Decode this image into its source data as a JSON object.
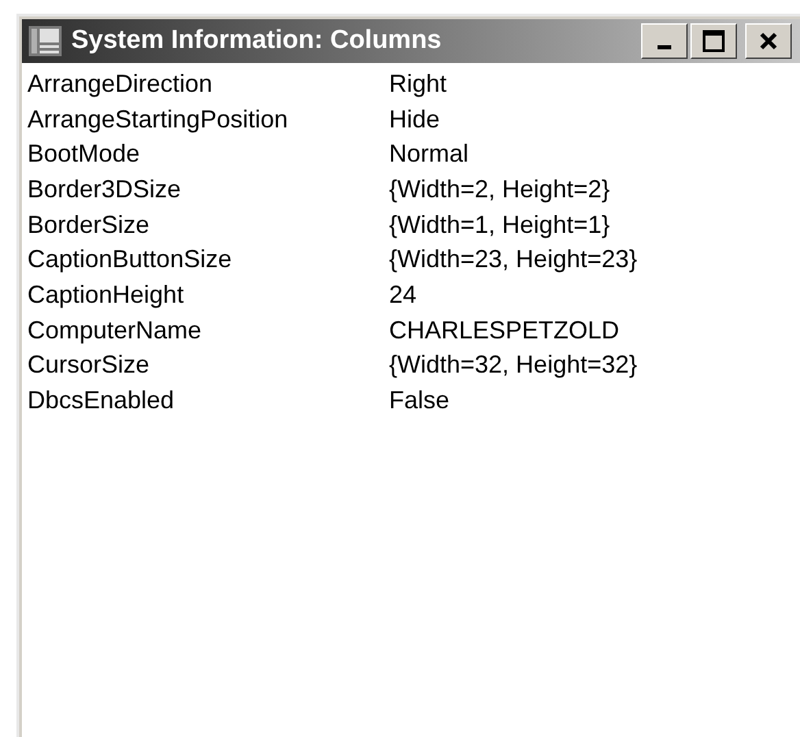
{
  "window": {
    "title": "System Information: Columns"
  },
  "rows": [
    {
      "property": "ArrangeDirection",
      "value": "Right"
    },
    {
      "property": "ArrangeStartingPosition",
      "value": "Hide"
    },
    {
      "property": "BootMode",
      "value": "Normal"
    },
    {
      "property": "Border3DSize",
      "value": "{Width=2, Height=2}"
    },
    {
      "property": "BorderSize",
      "value": "{Width=1, Height=1}"
    },
    {
      "property": "CaptionButtonSize",
      "value": "{Width=23, Height=23}"
    },
    {
      "property": "CaptionHeight",
      "value": "24"
    },
    {
      "property": "ComputerName",
      "value": "CHARLESPETZOLD"
    },
    {
      "property": "CursorSize",
      "value": "{Width=32, Height=32}"
    },
    {
      "property": "DbcsEnabled",
      "value": "False"
    }
  ]
}
